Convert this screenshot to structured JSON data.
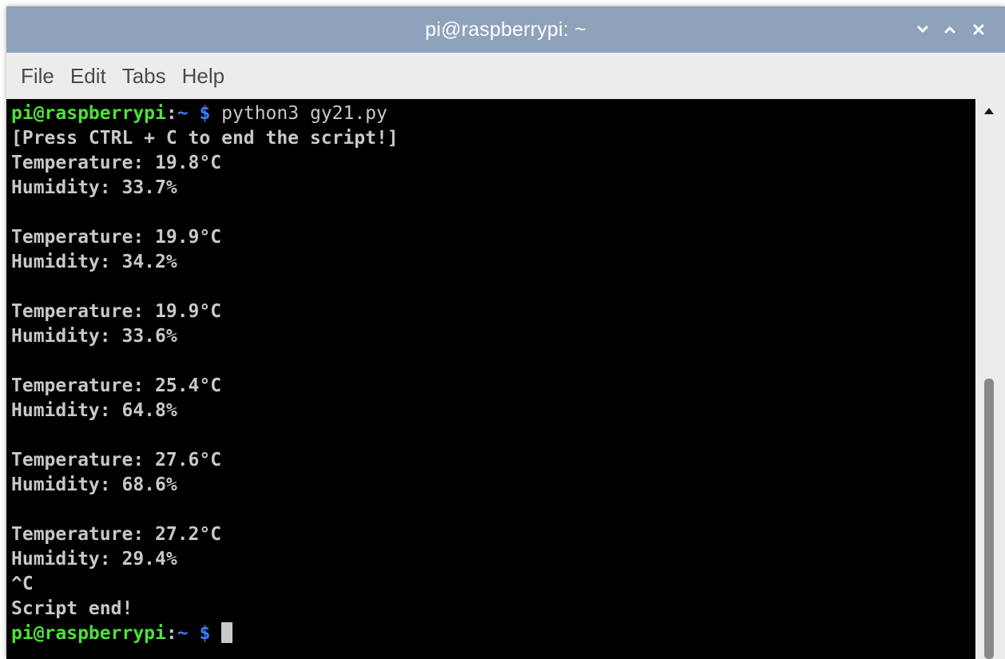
{
  "window": {
    "title": "pi@raspberrypi: ~"
  },
  "menu": {
    "items": [
      "File",
      "Edit",
      "Tabs",
      "Help"
    ]
  },
  "terminal": {
    "prompt": {
      "user_host": "pi@raspberrypi",
      "separator": ":",
      "path": "~",
      "dollar": "$"
    },
    "command": "python3 gy21.py",
    "output": [
      "[Press CTRL + C to end the script!]",
      "Temperature: 19.8°C",
      "Humidity: 33.7%",
      "",
      "Temperature: 19.9°C",
      "Humidity: 34.2%",
      "",
      "Temperature: 19.9°C",
      "Humidity: 33.6%",
      "",
      "Temperature: 25.4°C",
      "Humidity: 64.8%",
      "",
      "Temperature: 27.6°C",
      "Humidity: 68.6%",
      "",
      "Temperature: 27.2°C",
      "Humidity: 29.4%",
      "^C",
      "Script end!"
    ]
  },
  "icons": {
    "minimize": "chevron-down-icon",
    "maximize": "chevron-up-icon",
    "close": "close-icon",
    "scroll_up": "triangle-up-icon"
  },
  "colors": {
    "titlebar": "#8ea2bb",
    "terminal_bg": "#000000",
    "prompt_user": "#4ee13a",
    "prompt_path": "#3f7df5",
    "text": "#c8c8c8"
  }
}
